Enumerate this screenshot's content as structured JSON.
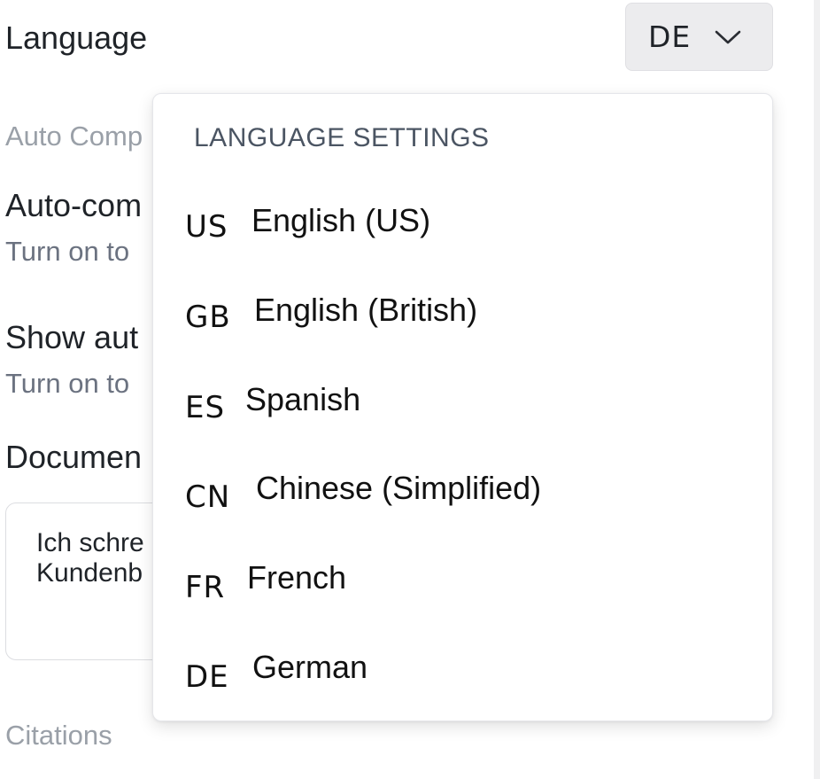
{
  "settings": {
    "language_title": "Language",
    "language_selected": "DE",
    "auto_section": "Auto Comp",
    "autocomplete_title": "Auto-com",
    "autocomplete_desc": "Turn on to",
    "show_title": "Show aut",
    "show_desc": "Turn on to",
    "document_title": "Documen",
    "document_line1": "Ich schre",
    "document_line2": "Kundenb",
    "citations_section": "Citations"
  },
  "dropdown": {
    "heading": "LANGUAGE SETTINGS",
    "items": [
      {
        "code": "US",
        "label": "English (US)"
      },
      {
        "code": "GB",
        "label": "English (British)"
      },
      {
        "code": "ES",
        "label": "Spanish"
      },
      {
        "code": "CN",
        "label": "Chinese (Simplified)"
      },
      {
        "code": "FR",
        "label": "French"
      },
      {
        "code": "DE",
        "label": "German"
      }
    ]
  },
  "icons": {
    "chevron": "chevron-down-icon"
  }
}
